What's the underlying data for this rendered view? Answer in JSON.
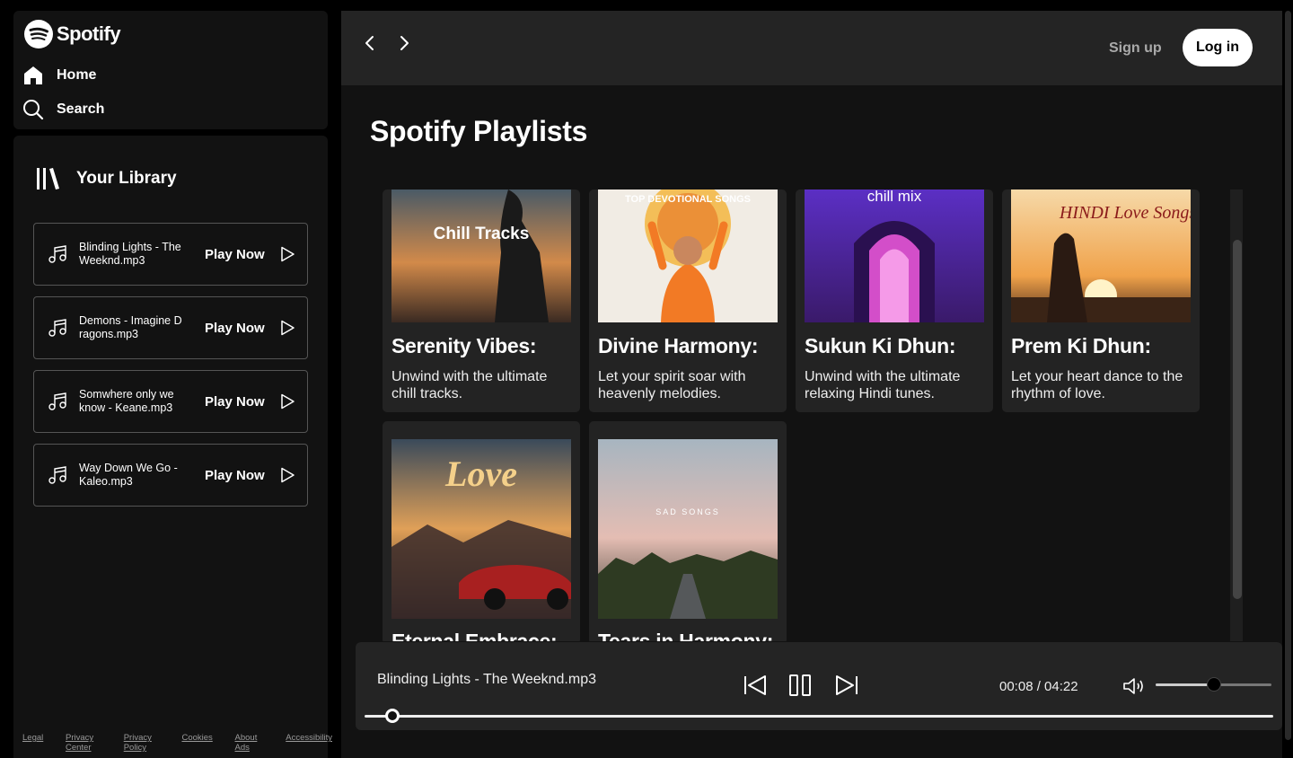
{
  "brand": {
    "name": "Spotify",
    "accent": "#ffffff"
  },
  "nav": {
    "home": "Home",
    "search": "Search"
  },
  "library": {
    "title": "Your Library",
    "tracks": [
      {
        "name": "Blinding Lights - The Weeknd.mp3",
        "action": "Play Now"
      },
      {
        "name": "Demons - Imagine D ragons.mp3",
        "action": "Play Now"
      },
      {
        "name": "Somwhere only we know - Keane.mp3",
        "action": "Play Now"
      },
      {
        "name": "Way Down We Go - Kaleo.mp3",
        "action": "Play Now"
      }
    ]
  },
  "footer": [
    "Legal",
    "Privacy Center",
    "Privacy Policy",
    "Cookies",
    "About Ads",
    "Accessibility"
  ],
  "header": {
    "signup": "Sign up",
    "login": "Log in"
  },
  "section": {
    "title": "Spotify Playlists"
  },
  "playlists": [
    {
      "title": "Serenity Vibes:",
      "desc": "Unwind with the ultimate chill tracks.",
      "cover_text": "Chill Tracks"
    },
    {
      "title": "Divine Harmony:",
      "desc": "Let your spirit soar with heavenly melodies.",
      "cover_text": "TOP DEVOTIONAL SONGS"
    },
    {
      "title": "Sukun Ki Dhun:",
      "desc": "Unwind with the ultimate relaxing Hindi tunes.",
      "cover_text": "chill mix"
    },
    {
      "title": "Prem Ki Dhun:",
      "desc": "Let your heart dance to the rhythm of love.",
      "cover_text": "HINDI Love Songs"
    },
    {
      "title": "Eternal Embrace:",
      "desc": "",
      "cover_text": "Love"
    },
    {
      "title": "Tears in Harmony:",
      "desc": "",
      "cover_text": "SAD SONGS"
    }
  ],
  "player": {
    "now_playing": "Blinding Lights - The Weeknd.mp3",
    "time": "00:08 / 04:22",
    "progress": 0.031,
    "volume": 0.5
  }
}
